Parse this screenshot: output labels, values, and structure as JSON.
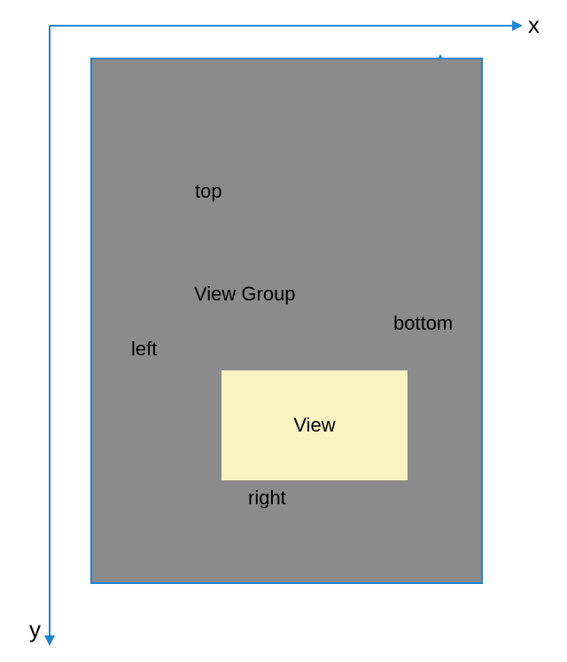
{
  "axis": {
    "x_label": "x",
    "y_label": "y"
  },
  "labels": {
    "top": "top",
    "left": "left",
    "right": "right",
    "bottom": "bottom",
    "view_group": "View Group",
    "view": "View"
  },
  "colors": {
    "axis": "#1b87d6",
    "container": "#8b8b8b",
    "view": "#fbf2c2"
  }
}
